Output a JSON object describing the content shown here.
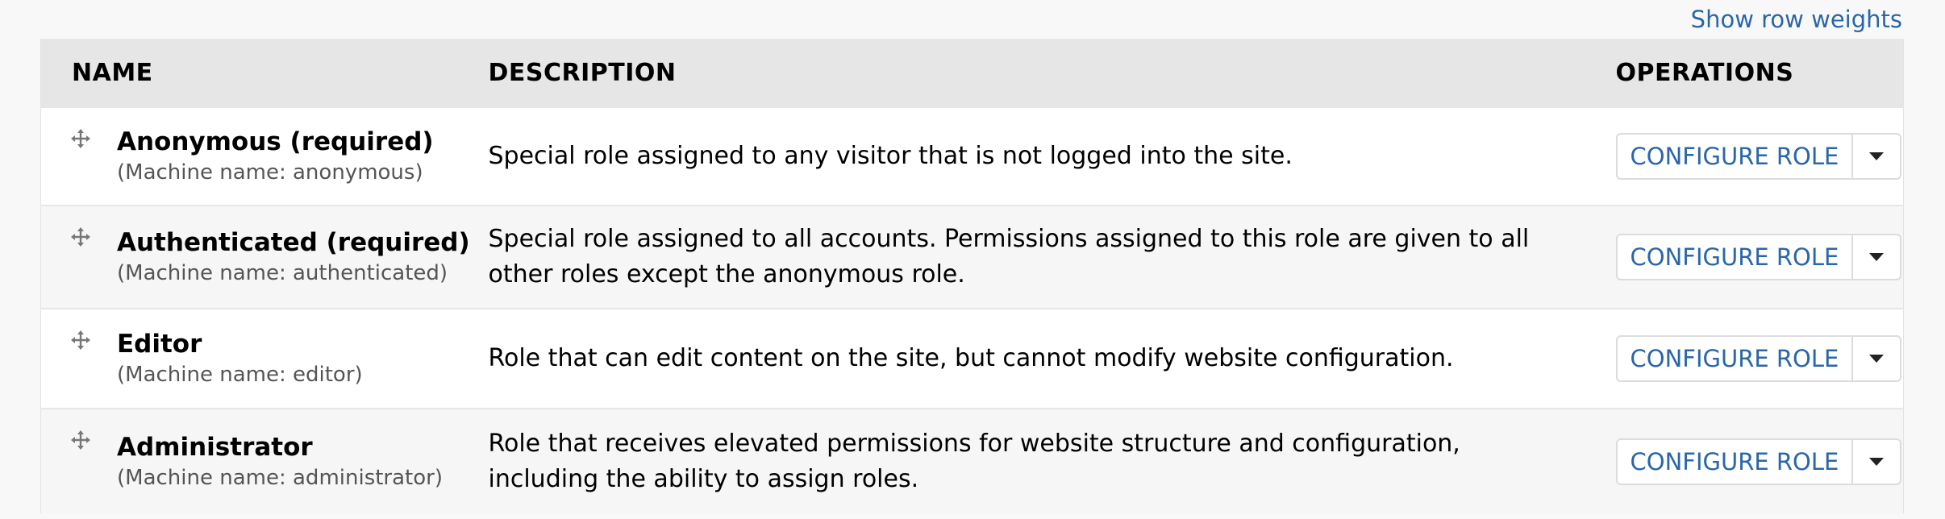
{
  "show_row_weights_label": "Show row weights",
  "table": {
    "headers": {
      "name": "NAME",
      "description": "DESCRIPTION",
      "operations": "OPERATIONS"
    },
    "rows": [
      {
        "label": "Anonymous (required)",
        "machine_name": "(Machine name: anonymous)",
        "description": "Special role assigned to any visitor that is not logged into the site.",
        "operation": "CONFIGURE ROLE"
      },
      {
        "label": "Authenticated (required)",
        "machine_name": "(Machine name: authenticated)",
        "description": "Special role assigned to all accounts. Permissions assigned to this role are given to all other roles except the anonymous role.",
        "operation": "CONFIGURE ROLE"
      },
      {
        "label": "Editor",
        "machine_name": "(Machine name: editor)",
        "description": "Role that can edit content on the site, but cannot modify website configuration.",
        "operation": "CONFIGURE ROLE"
      },
      {
        "label": "Administrator",
        "machine_name": "(Machine name: administrator)",
        "description": "Role that receives elevated permissions for website structure and configuration, including the ability to assign roles.",
        "operation": "CONFIGURE ROLE"
      }
    ]
  },
  "colors": {
    "link": "#2a66a8",
    "header_bg": "#e6e6e6",
    "row_odd": "#ffffff",
    "row_even": "#f6f6f6"
  },
  "icons": {
    "drag": "move-arrows-icon",
    "dropdown": "caret-down-icon"
  }
}
